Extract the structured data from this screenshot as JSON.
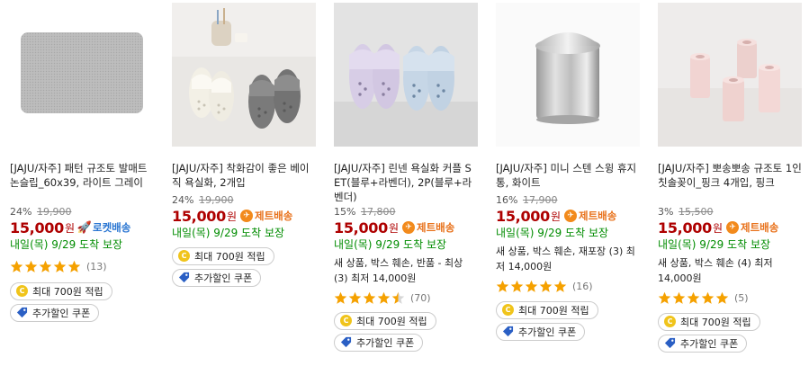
{
  "products": [
    {
      "name": "[JAJU/자주] 패턴 규조토 발매트 논슬립_60x39, 라이트 그레이",
      "discount": "24%",
      "original_price": "19,900",
      "price": "15,000",
      "won": "원",
      "badge": "로켓배송",
      "badge_icon": "rocket-icon",
      "arrival": "내일(목) 9/29 도착 보장",
      "rating": 5,
      "review_count": "(13)",
      "coupon_points": "최대 700원 적립",
      "coupon_discount": "추가할인 쿠폰"
    },
    {
      "name": "[JAJU/자주] 착화감이 좋은 베이직 욕실화, 2개입",
      "discount": "24%",
      "original_price": "19,900",
      "price": "15,000",
      "won": "원",
      "badge": "제트배송",
      "badge_icon": "jet-icon",
      "arrival": "내일(목) 9/29 도착 보장",
      "coupon_points": "최대 700원 적립",
      "coupon_discount": "추가할인 쿠폰"
    },
    {
      "name": "[JAJU/자주] 린넨 욕실화 커플 SET(블루+라벤더), 2P(블루+라벤더)",
      "discount": "15%",
      "original_price": "17,800",
      "price": "15,000",
      "won": "원",
      "badge": "제트배송",
      "badge_icon": "jet-icon",
      "arrival": "내일(목) 9/29 도착 보장",
      "other_sellers": "새 상품, 박스 훼손, 반품 - 최상 (3) 최저 14,000원",
      "rating": 4.5,
      "review_count": "(70)",
      "coupon_points": "최대 700원 적립",
      "coupon_discount": "추가할인 쿠폰"
    },
    {
      "name": "[JAJU/자주] 미니 스텐 스윙 휴지통, 화이트",
      "discount": "16%",
      "original_price": "17,900",
      "price": "15,000",
      "won": "원",
      "badge": "제트배송",
      "badge_icon": "jet-icon",
      "arrival": "내일(목) 9/29 도착 보장",
      "other_sellers": "새 상품, 박스 훼손, 재포장 (3) 최저 14,000원",
      "rating": 5,
      "review_count": "(16)",
      "coupon_points": "최대 700원 적립",
      "coupon_discount": "추가할인 쿠폰"
    },
    {
      "name": "[JAJU/자주] 뽀송뽀송 규조토 1인 칫솔꽂이_핑크 4개입, 핑크",
      "discount": "3%",
      "original_price": "15,500",
      "price": "15,000",
      "won": "원",
      "badge": "제트배송",
      "badge_icon": "jet-icon",
      "arrival": "내일(목) 9/29 도착 보장",
      "other_sellers": "새 상품, 박스 훼손 (4) 최저 14,000원",
      "rating": 5,
      "review_count": "(5)",
      "coupon_points": "최대 700원 적립",
      "coupon_discount": "추가할인 쿠폰"
    }
  ],
  "colors": {
    "price": "#ae0000",
    "arrival": "#008c00",
    "jet": "#e8711a",
    "rocket": "#2a76d2",
    "star": "#f5a100"
  }
}
